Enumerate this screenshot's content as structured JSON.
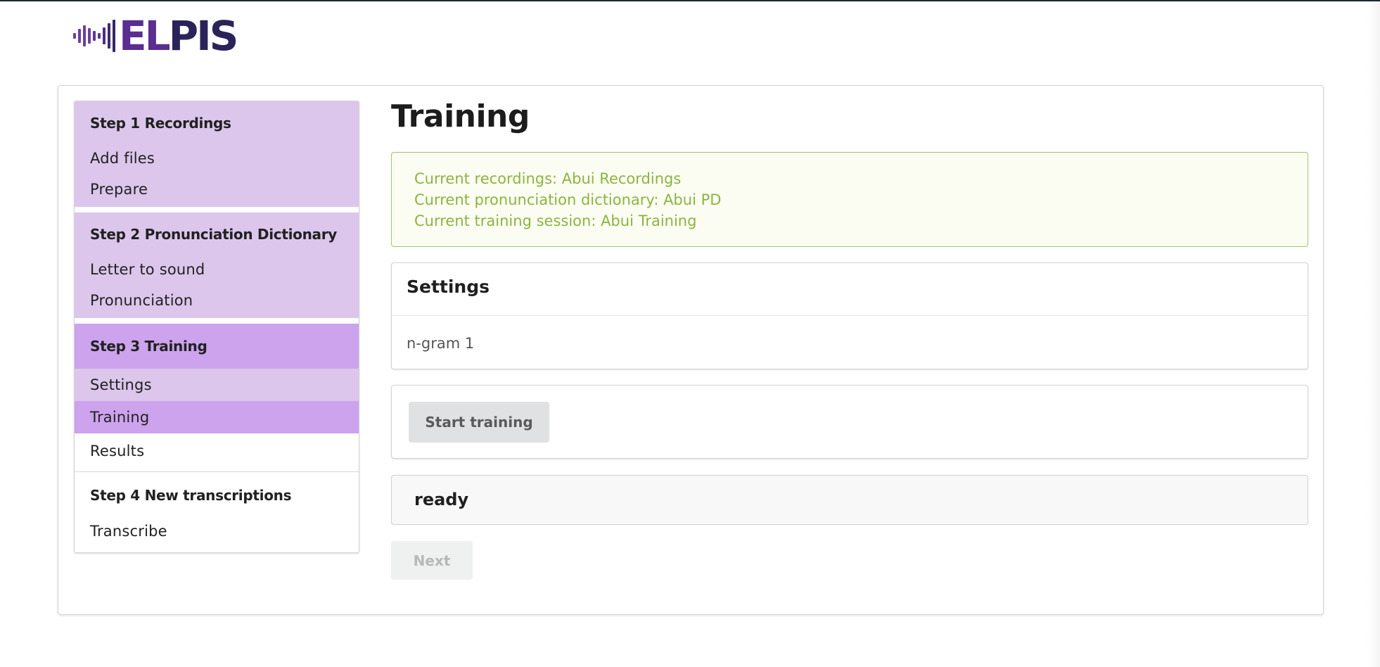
{
  "logo": {
    "text_el": "EL",
    "text_pis": "PIS",
    "brand_purple": "#5a2d91",
    "brand_navy": "#2a2359"
  },
  "sidebar": {
    "steps": [
      {
        "title": "Step 1 Recordings",
        "items": [
          "Add files",
          "Prepare"
        ]
      },
      {
        "title": "Step 2 Pronunciation Dictionary",
        "items": [
          "Letter to sound",
          "Pronunciation"
        ]
      },
      {
        "title": "Step 3 Training",
        "items": [
          "Settings",
          "Training",
          "Results"
        ],
        "active_item": "Training"
      },
      {
        "title": "Step 4 New transcriptions",
        "items": [
          "Transcribe"
        ]
      }
    ],
    "colors": {
      "completed": "#dcc6ec",
      "active": "#cca3ec"
    }
  },
  "main": {
    "title": "Training",
    "info": {
      "recordings": "Current recordings: Abui Recordings",
      "dictionary": "Current pronunciation dictionary: Abui PD",
      "session": "Current training session: Abui Training"
    },
    "settings": {
      "header": "Settings",
      "value": "n-gram 1"
    },
    "start_button": "Start training",
    "status": "ready",
    "next_button": "Next"
  }
}
